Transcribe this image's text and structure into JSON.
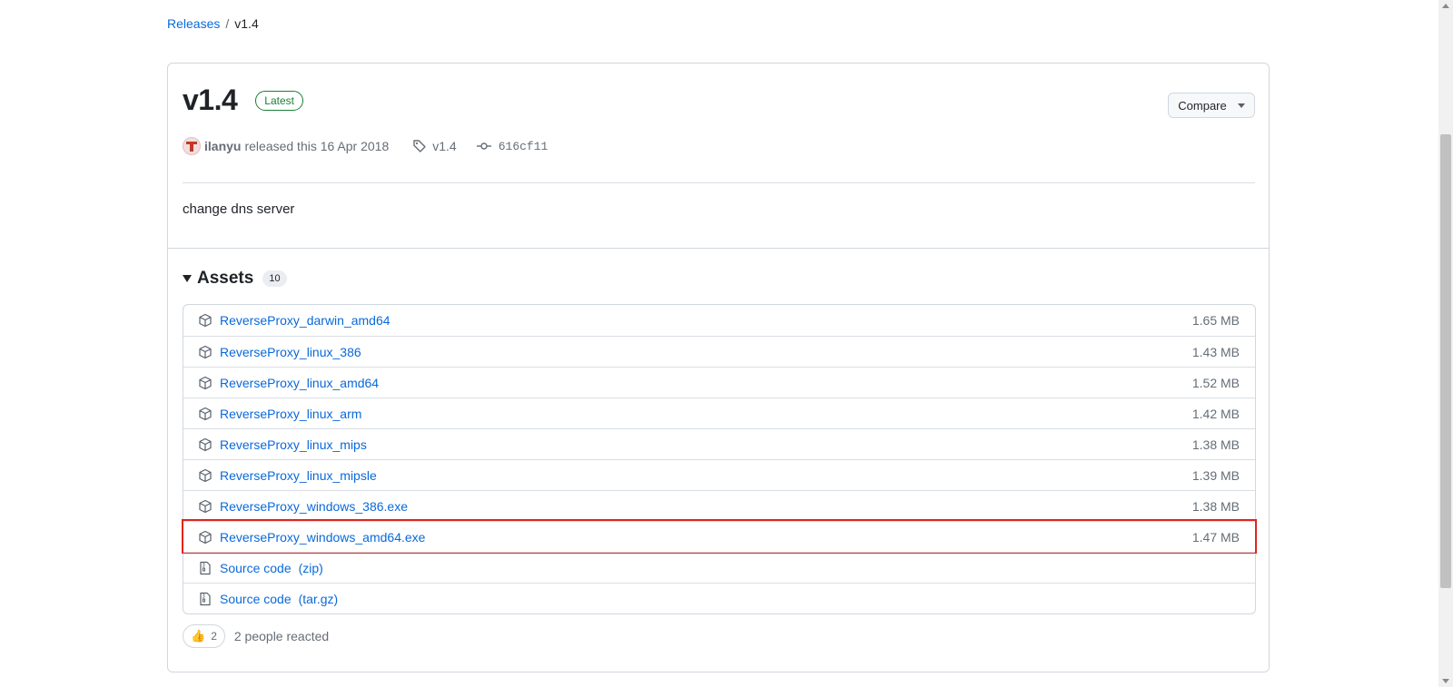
{
  "breadcrumb": {
    "parent": "Releases",
    "separator": "/",
    "current": "v1.4"
  },
  "release": {
    "title": "v1.4",
    "badge": "Latest",
    "compare_label": "Compare",
    "author": "ilanyu",
    "released_text": "released this 16 Apr 2018",
    "tag": "v1.4",
    "commit": "616cf11",
    "description": "change dns server"
  },
  "assets": {
    "title": "Assets",
    "count": "10",
    "items": [
      {
        "name": "ReverseProxy_darwin_amd64",
        "size": "1.65 MB"
      },
      {
        "name": "ReverseProxy_linux_386",
        "size": "1.43 MB"
      },
      {
        "name": "ReverseProxy_linux_amd64",
        "size": "1.52 MB"
      },
      {
        "name": "ReverseProxy_linux_arm",
        "size": "1.42 MB"
      },
      {
        "name": "ReverseProxy_linux_mips",
        "size": "1.38 MB"
      },
      {
        "name": "ReverseProxy_linux_mipsle",
        "size": "1.39 MB"
      },
      {
        "name": "ReverseProxy_windows_386.exe",
        "size": "1.38 MB"
      },
      {
        "name": "ReverseProxy_windows_amd64.exe",
        "size": "1.47 MB"
      }
    ],
    "source": [
      {
        "label": "Source code",
        "ext": "(zip)"
      },
      {
        "label": "Source code",
        "ext": "(tar.gz)"
      }
    ]
  },
  "reactions": {
    "emoji": "👍",
    "count": "2",
    "text": "2 people reacted"
  },
  "icons": {
    "asset": "package-icon",
    "source": "file-zip-icon",
    "tag": "tag-icon",
    "commit": "git-commit-icon"
  },
  "colors": {
    "link": "#0969da",
    "latest": "#1a7f37",
    "highlight": "#e3231c",
    "border": "#d0d7de"
  }
}
